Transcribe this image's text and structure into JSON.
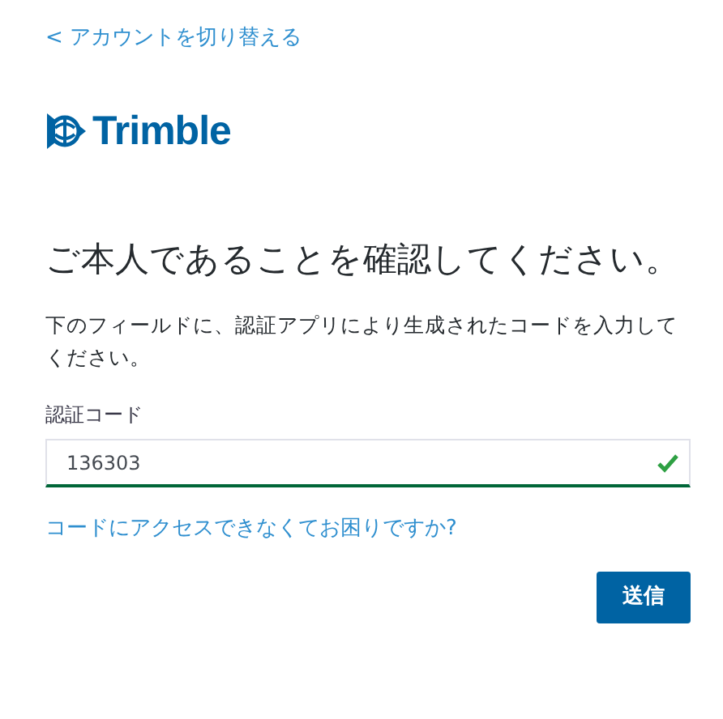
{
  "back_link": "< アカウントを切り替える",
  "logo": {
    "text": "Trimble"
  },
  "heading": "ご本人であることを確認してください。",
  "description": "下のフィールドに、認証アプリにより生成されたコードを入力してください。",
  "code_field": {
    "label": "認証コード",
    "value": "136303",
    "valid": true
  },
  "help_link": "コードにアクセスできなくてお困りですか?",
  "submit_button": "送信"
}
